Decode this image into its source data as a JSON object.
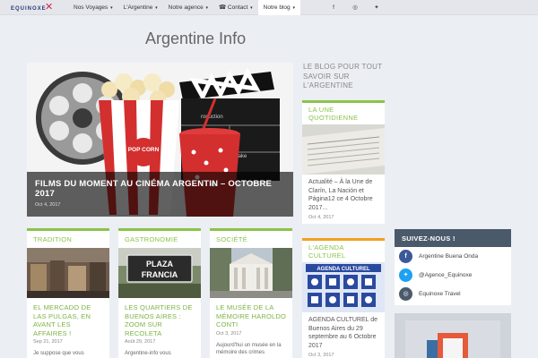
{
  "logo": {
    "text": "EQUINOXE",
    "mark": "✕"
  },
  "nav": [
    {
      "label": "Nos Voyages",
      "caret": "▾"
    },
    {
      "label": "L'Argentine",
      "caret": "▾"
    },
    {
      "label": "Notre agence",
      "caret": "▾"
    },
    {
      "label": "☎ Contact",
      "caret": "▾"
    },
    {
      "label": "Notre blog",
      "caret": "▾"
    }
  ],
  "social_nav": [
    "f",
    "◎",
    "✦"
  ],
  "page_title": "Argentine Info",
  "hero": {
    "title": "FILMS DU MOMENT AU CINÉMA ARGENTIN – OCTOBRE 2017",
    "date": "Oct 4, 2017",
    "popcorn_text": "POP CORN",
    "clapper_text_1": "roduction",
    "clapper_text_2": "take"
  },
  "cards": [
    {
      "category": "TRADITION",
      "title": "EL MERCADO DE LAS PULGAS, EN AVANT LES AFFAIRES !",
      "date": "Sep 21, 2017",
      "text": "Je suppose que vous",
      "bar": "#8bc34a"
    },
    {
      "category": "GASTRONOMIE",
      "title": "LES QUARTIERS DE BUENOS AIRES : ZOOM SUR RECOLETA",
      "date": "Août 29, 2017",
      "text": "Argentine-info vous",
      "bar": "#8bc34a",
      "sign_1": "PLAZA",
      "sign_2": "FRANCIA"
    },
    {
      "category": "SOCIÉTÉ",
      "title": "LE MUSÉE DE LA MÉMOIRE HAROLDO CONTI",
      "date": "Oct 3, 2017",
      "text": "Aujourd'hui un musée en la mémoire des crimes",
      "bar": "#8bc34a"
    }
  ],
  "blog": {
    "heading": "LE BLOG POUR TOUT SAVOIR SUR L'ARGENTINE",
    "side1": {
      "category": "LA UNE QUOTIDIENNE",
      "title": "Actualité – À la Une de Clarín, La Nación et Página12 ce 4 Octobre 2017...",
      "date": "Oct 4, 2017"
    },
    "side2": {
      "category": "L'AGENDA CULTUREL",
      "banner": "AGENDA CULTUREL",
      "title": "AGENDA CULTUREL de Buenos Aires du 29 septembre au 6 Octobre 2017",
      "date": "Oct 3, 2017"
    }
  },
  "follow": {
    "heading": "SUIVEZ-NOUS !",
    "items": [
      {
        "icon": "f",
        "label": "Argentine Buena Onda",
        "color": "#3b5998"
      },
      {
        "icon": "✦",
        "label": "@Agence_Equinoxe",
        "color": "#1da1f2"
      },
      {
        "icon": "◎",
        "label": "Equinoxe Travel",
        "color": "#4b5a6b"
      }
    ]
  },
  "colors": {
    "accent_green": "#8bc34a",
    "nav_bg": "#e4e6eb",
    "page_bg": "#ebeef3"
  }
}
